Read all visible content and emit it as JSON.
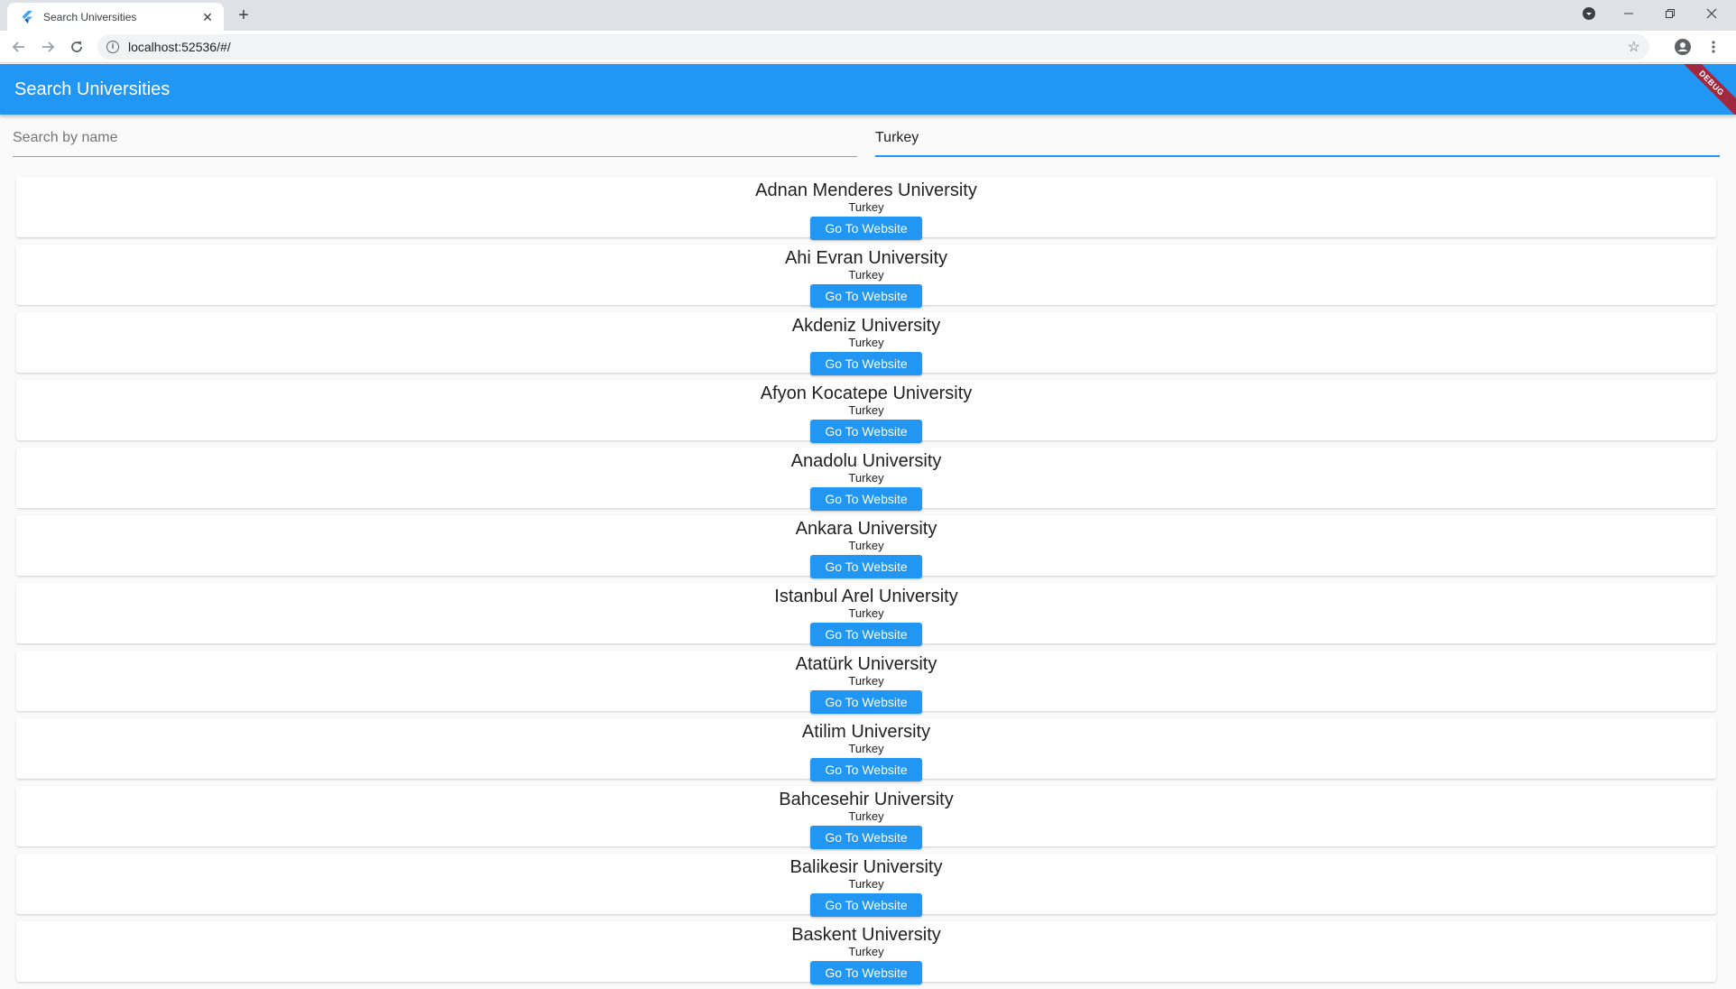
{
  "browser": {
    "tab_title": "Search Universities",
    "tab_close": "✕",
    "new_tab": "+",
    "url": "localhost:52536/#/"
  },
  "appbar": {
    "title": "Search Universities",
    "debug_label": "DEBUG"
  },
  "search": {
    "name_placeholder": "Search by name",
    "name_value": "",
    "country_value": "Turkey"
  },
  "button_label": "Go To Website",
  "universities": [
    {
      "name": "Adnan Menderes University",
      "country": "Turkey"
    },
    {
      "name": "Ahi Evran University",
      "country": "Turkey"
    },
    {
      "name": "Akdeniz University",
      "country": "Turkey"
    },
    {
      "name": "Afyon Kocatepe University",
      "country": "Turkey"
    },
    {
      "name": "Anadolu University",
      "country": "Turkey"
    },
    {
      "name": "Ankara University",
      "country": "Turkey"
    },
    {
      "name": "Istanbul Arel University",
      "country": "Turkey"
    },
    {
      "name": "Atatürk University",
      "country": "Turkey"
    },
    {
      "name": "Atilim University",
      "country": "Turkey"
    },
    {
      "name": "Bahcesehir University",
      "country": "Turkey"
    },
    {
      "name": "Balikesir University",
      "country": "Turkey"
    },
    {
      "name": "Baskent University",
      "country": "Turkey"
    }
  ],
  "colors": {
    "primary": "#2196f3",
    "debug_banner": "#a0293f"
  }
}
